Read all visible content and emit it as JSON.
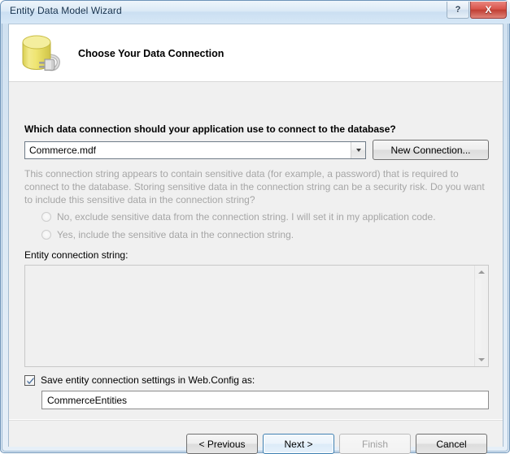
{
  "window": {
    "title": "Entity Data Model Wizard",
    "caption_buttons": [
      {
        "name": "help-button",
        "label": "?"
      },
      {
        "name": "close-button",
        "label": "X"
      }
    ]
  },
  "header": {
    "title": "Choose Your Data Connection",
    "icon": "database-connection-icon"
  },
  "main": {
    "question_label": "Which data connection should your application use to connect to the database?",
    "connection_combo": {
      "value": "Commerce.mdf",
      "options": [
        "Commerce.mdf"
      ]
    },
    "new_connection_button": "New Connection...",
    "sensitive_note": "This connection string appears to contain sensitive data (for example, a password) that is required to connect to the database. Storing sensitive data in the connection string can be a security risk. Do you want to include this sensitive data in the connection string?",
    "radios": [
      {
        "label": "No, exclude sensitive data from the connection string. I will set it in my application code.",
        "selected": false,
        "enabled": false
      },
      {
        "label": "Yes, include the sensitive data in the connection string.",
        "selected": false,
        "enabled": false
      }
    ],
    "entity_connection_string": {
      "label": "Entity connection string:",
      "value": ""
    },
    "save_settings": {
      "checked": true,
      "label": "Save entity connection settings in Web.Config as:",
      "value": "CommerceEntities"
    }
  },
  "footer": {
    "buttons": [
      {
        "name": "previous-button",
        "label": "< Previous",
        "state": "normal"
      },
      {
        "name": "next-button",
        "label": "Next >",
        "state": "default"
      },
      {
        "name": "finish-button",
        "label": "Finish",
        "state": "disabled"
      },
      {
        "name": "cancel-button",
        "label": "Cancel",
        "state": "normal"
      }
    ]
  },
  "colors": {
    "accent": "#3c7fb1",
    "close_red": "#c03f34",
    "disabled_text": "#a6a6a6",
    "icon_yellow": "#e8e06a"
  }
}
